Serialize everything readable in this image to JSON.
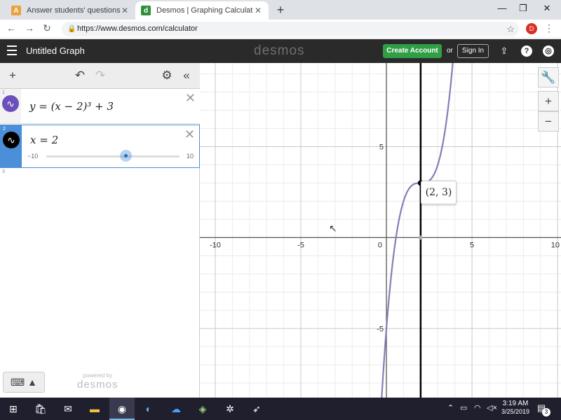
{
  "browser": {
    "tabs": [
      {
        "title": "Answer students' questions and ",
        "favicon": "A",
        "active": false
      },
      {
        "title": "Desmos | Graphing Calculator",
        "favicon": "d",
        "active": true
      }
    ],
    "new_tab": "+",
    "url": "https://www.desmos.com/calculator",
    "profile_initial": "D",
    "window_controls": {
      "minimize": "—",
      "maximize": "❐",
      "close": "✕"
    },
    "nav": {
      "back": "←",
      "forward": "→",
      "reload": "↻",
      "lock": "🔒",
      "star": "☆",
      "menu": "⋮"
    }
  },
  "header": {
    "graph_title": "Untitled Graph",
    "brand": "desmos",
    "create_account": "Create Account",
    "or": "or",
    "sign_in": "Sign In",
    "icons": [
      "share-icon",
      "help-icon",
      "globe-icon"
    ]
  },
  "expressions_toolbar": {
    "add": "+",
    "undo": "↶",
    "redo": "↷",
    "settings": "⚙",
    "collapse": "«"
  },
  "expressions": [
    {
      "index": "1",
      "latex": "y = (x − 2)³ + 3",
      "color": "#6b4fbb",
      "selected": false
    },
    {
      "index": "2",
      "latex": "x = 2",
      "color": "#000000",
      "selected": true,
      "slider": {
        "min": "−10",
        "max": "10",
        "value": 2
      }
    }
  ],
  "empty_expression_index": "3",
  "keyboard_button": "⌨ ▲",
  "powered_by": {
    "small": "powered by",
    "big": "desmos"
  },
  "graph": {
    "x_range": [
      -10.9,
      10.2
    ],
    "y_range": [
      -8.8,
      9.6
    ],
    "x_ticks": [
      {
        "value": -10,
        "label": "-10"
      },
      {
        "value": -5,
        "label": "-5"
      },
      {
        "value": 0,
        "label": "0"
      },
      {
        "value": 5,
        "label": "5"
      },
      {
        "value": 10,
        "label": "10"
      }
    ],
    "y_ticks": [
      {
        "value": 5,
        "label": "5"
      },
      {
        "value": -5,
        "label": "-5"
      }
    ],
    "point_label": "(2, 3)",
    "point": [
      2,
      3
    ],
    "curve_color": "#8c7ab8",
    "vline_color": "#000000",
    "zoom_controls": {
      "tools": "🔧",
      "zoom_in": "+",
      "zoom_out": "−"
    }
  },
  "taskbar": {
    "time": "3:19 AM",
    "date": "3/25/2019",
    "notifications": "3"
  }
}
